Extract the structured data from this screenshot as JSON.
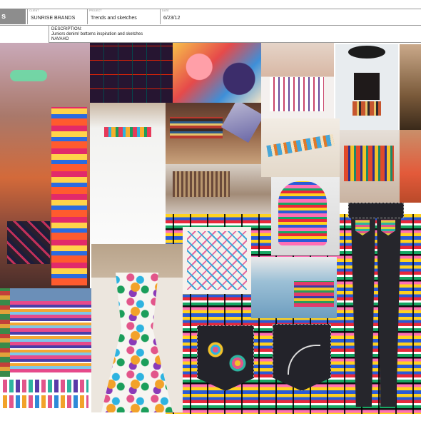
{
  "header": {
    "tab_label": "s",
    "fields": [
      {
        "caption": "CLIENT",
        "value": "SUNRISE BRANDS"
      },
      {
        "caption": "PROJECT",
        "value": "Trends and sketches"
      },
      {
        "caption": "DATE",
        "value": "6/23/12"
      }
    ]
  },
  "description": {
    "label": "DESCRIPTION:",
    "line1": "Juniors denim/ bottoms inspiration and sketches",
    "line2": "NAVAHO"
  },
  "colors": {
    "header_tab": "#8d8d8d",
    "rule": "#9a9a9a",
    "denim": "#23232a",
    "tribal_yellow": "#ffd21f",
    "tribal_blue": "#2a5bd7",
    "tribal_red": "#e8283a",
    "tribal_green": "#17a663",
    "tribal_pink": "#ff6fb5"
  }
}
